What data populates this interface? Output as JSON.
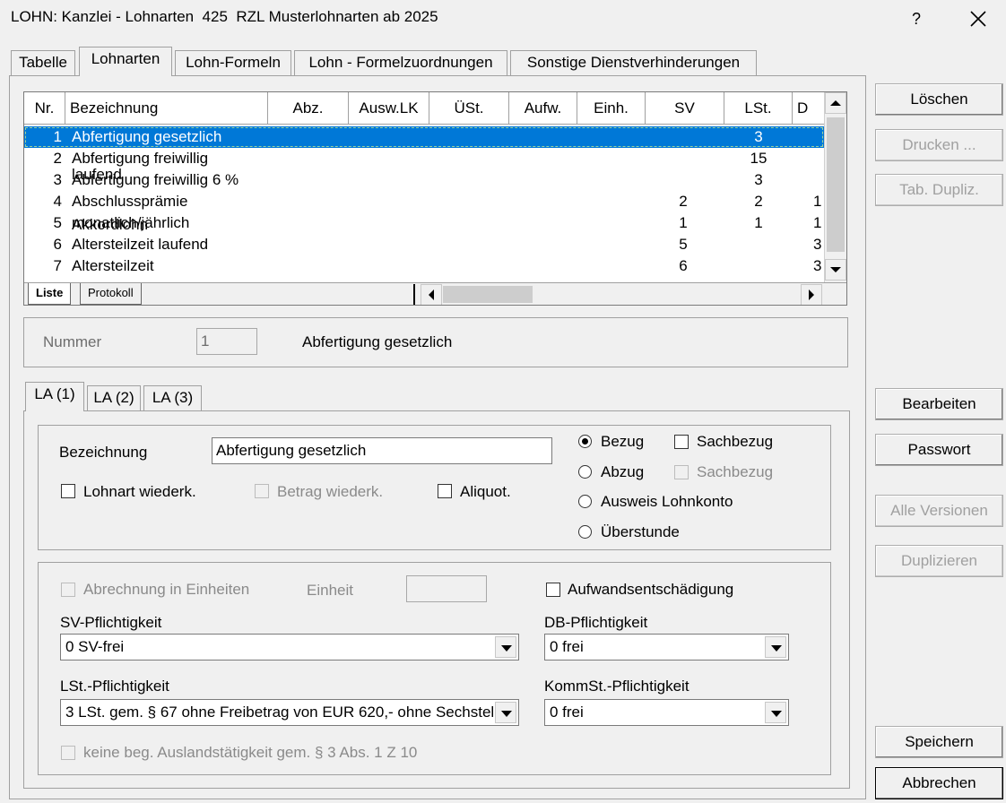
{
  "window": {
    "title": "LOHN: Kanzlei - Lohnarten  425  RZL Musterlohnarten ab 2025",
    "help_label": "?"
  },
  "tabs": [
    "Tabelle",
    "Lohnarten",
    "Lohn-Formeln",
    "Lohn - Formelzuordnungen",
    "Sonstige Dienstverhinderungen"
  ],
  "grid": {
    "columns": [
      "Nr.",
      "Bezeichnung",
      "Abz.",
      "Ausw.LK",
      "ÜSt.",
      "Aufw.",
      "Einh.",
      "SV",
      "LSt.",
      "D"
    ],
    "rows": [
      {
        "nr": "1",
        "bez": "Abfertigung gesetzlich",
        "sv": "",
        "lst": "3",
        "d": ""
      },
      {
        "nr": "2",
        "bez": "Abfertigung freiwillig",
        "sv": "",
        "lst": "15",
        "d": ""
      },
      {
        "nr": "3",
        "bez": "Abfertigung freiwillig 6 %",
        "overlay": "laufend",
        "sv": "",
        "lst": "3",
        "d": ""
      },
      {
        "nr": "4",
        "bez": "Abschlussprämie",
        "sv": "2",
        "lst": "2",
        "d": "1"
      },
      {
        "nr": "5",
        "bez": "monatlich/jährlich",
        "overlay": "Akkordlohn",
        "sv": "1",
        "lst": "1",
        "d": "1"
      },
      {
        "nr": "6",
        "bez": "Altersteilzeit laufend",
        "sv": "5",
        "lst": "",
        "d": "3"
      },
      {
        "nr": "7",
        "bez": "Altersteilzeit",
        "sv": "6",
        "lst": "",
        "d": "3"
      }
    ],
    "sheet_tabs": [
      "Liste",
      "Protokoll"
    ]
  },
  "nummer": {
    "label": "Nummer",
    "value": "1",
    "name": "Abfertigung gesetzlich"
  },
  "inner_tabs": [
    "LA (1)",
    "LA (2)",
    "LA (3)"
  ],
  "form": {
    "bezeichnung_label": "Bezeichnung",
    "bezeichnung_value": "Abfertigung gesetzlich",
    "lohnart_wiederk": "Lohnart wiederk.",
    "betrag_wiederk": "Betrag wiederk.",
    "aliquot": "Aliquot.",
    "bezug": "Bezug",
    "sachbezug_1": "Sachbezug",
    "abzug": "Abzug",
    "sachbezug_2": "Sachbezug",
    "ausweis_lohnkonto": "Ausweis Lohnkonto",
    "ueberstunde": "Überstunde",
    "abrechnung_einheiten": "Abrechnung in Einheiten",
    "einheit_label": "Einheit",
    "einheit_value": "",
    "aufwandsentschaedigung": "Aufwandsentschädigung",
    "sv_label": "SV-Pflichtigkeit",
    "sv_value": "0 SV-frei",
    "db_label": "DB-Pflichtigkeit",
    "db_value": "0 frei",
    "lst_label": "LSt.-Pflichtigkeit",
    "lst_value": "3 LSt. gem. § 67 ohne Freibetrag von EUR 620,- ohne Sechstel",
    "komm_label": "KommSt.-Pflichtigkeit",
    "komm_value": "0 frei",
    "ausland": "keine beg. Auslandstätigkeit gem. § 3 Abs. 1 Z 10"
  },
  "buttons": {
    "loeschen": "Löschen",
    "drucken": "Drucken ...",
    "tab_dupliz": "Tab. Dupliz.",
    "bearbeiten": "Bearbeiten",
    "passwort": "Passwort",
    "alle_versionen": "Alle Versionen",
    "duplizieren": "Duplizieren",
    "speichern": "Speichern",
    "abbrechen": "Abbrechen"
  },
  "colors": {
    "selection": "#0078d7",
    "background": "#f0f0f0"
  }
}
